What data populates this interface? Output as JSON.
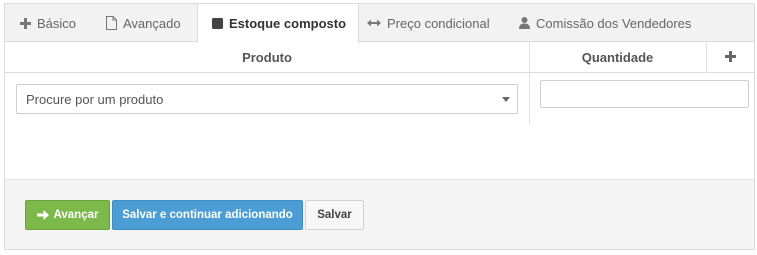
{
  "tabs": [
    {
      "label": "Básico",
      "icon": "plus-icon"
    },
    {
      "label": "Avançado",
      "icon": "document-icon"
    },
    {
      "label": "Estoque composto",
      "icon": "square-icon"
    },
    {
      "label": "Preço condicional",
      "icon": "double-arrow-icon"
    },
    {
      "label": "Comissão dos Vendedores",
      "icon": "user-icon"
    }
  ],
  "grid": {
    "col_product": "Produto",
    "col_quantity": "Quantidade",
    "add_icon": "plus-icon"
  },
  "row": {
    "product_placeholder": "Procure por um produto",
    "quantity_value": ""
  },
  "actions": {
    "next": "Avançar",
    "save_continue": "Salvar e continuar adicionando",
    "save": "Salvar"
  },
  "colors": {
    "next_button": "#7cb84a",
    "save_continue_button": "#4b9dd3",
    "active_tab_icon": "#444444"
  }
}
